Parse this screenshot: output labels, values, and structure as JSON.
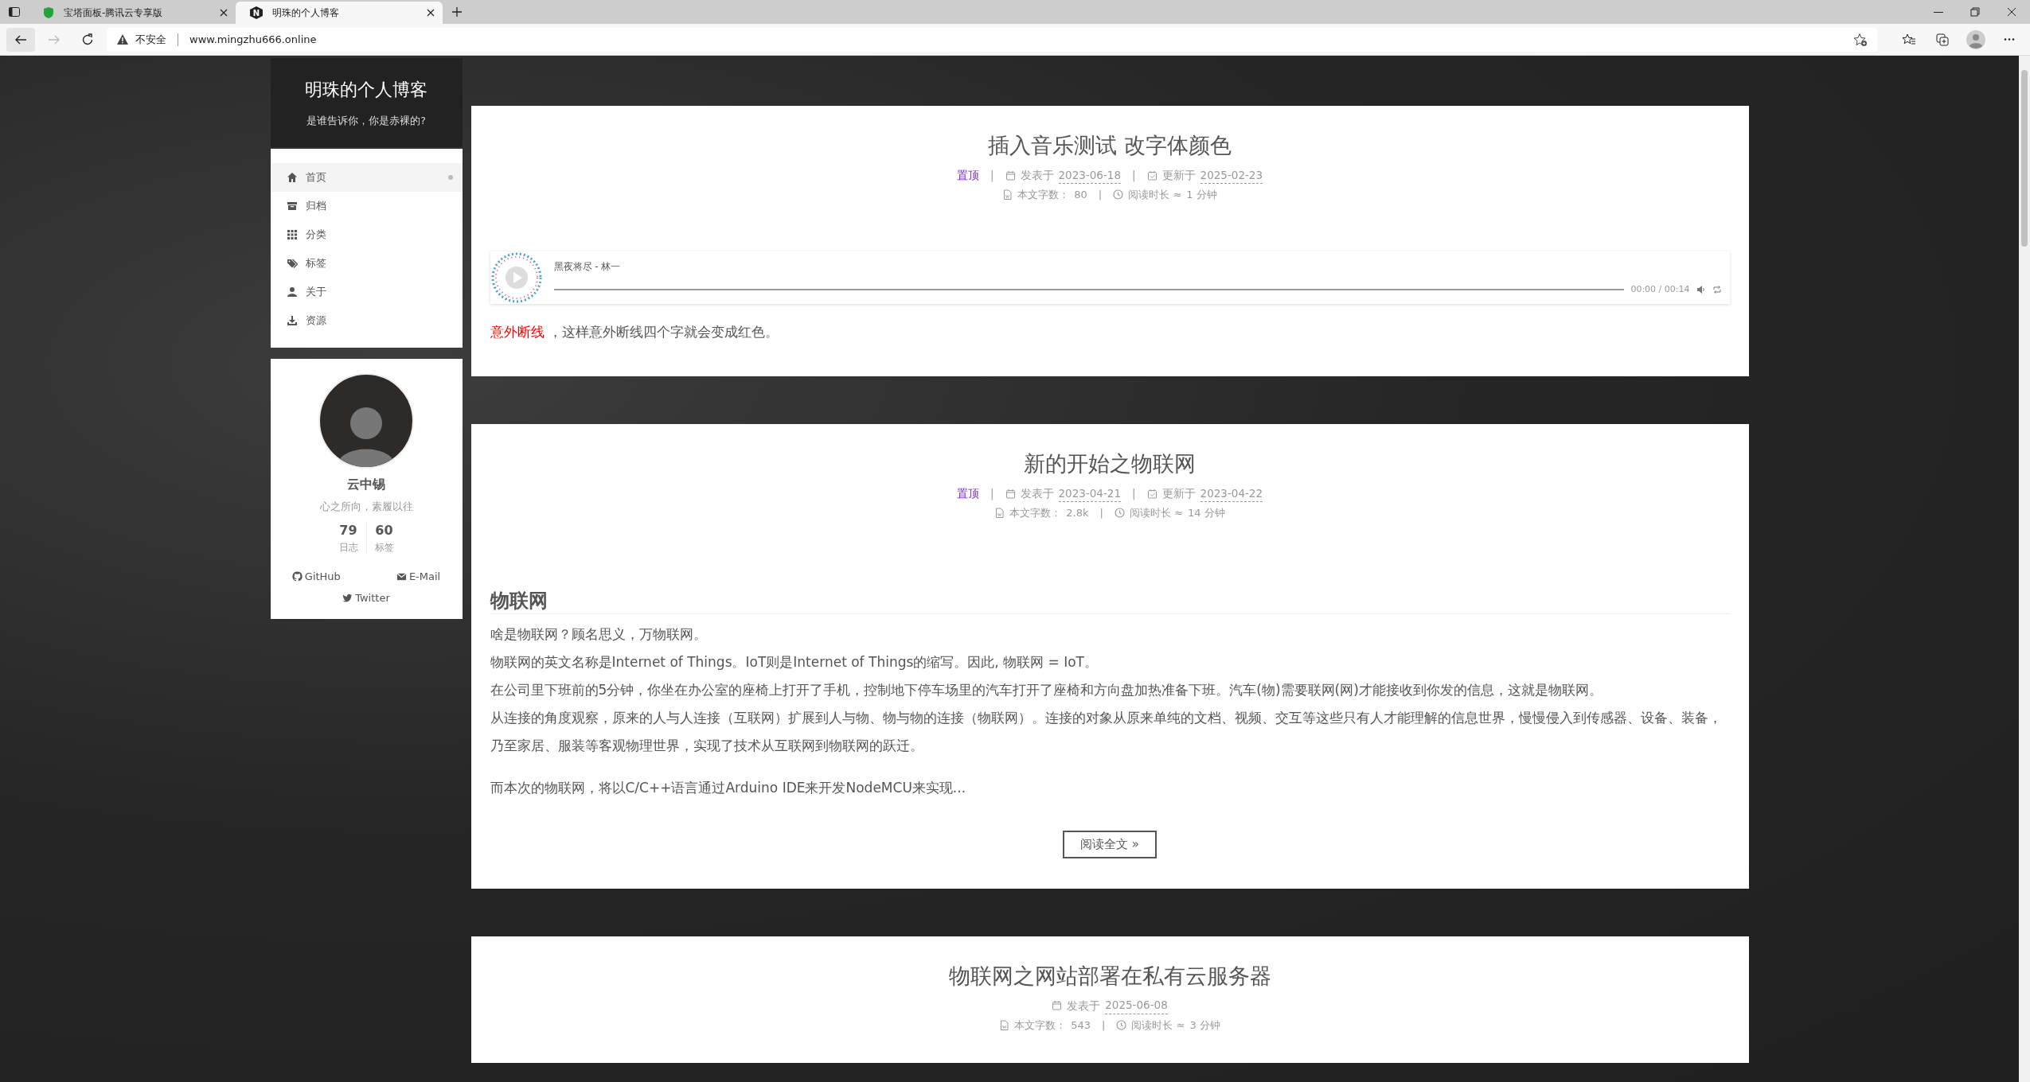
{
  "browser": {
    "tabs": [
      {
        "title": "宝塔面板-腾讯云专享版",
        "selected": false,
        "kind": "shield"
      },
      {
        "title": "明珠的个人博客",
        "selected": true,
        "kind": "letter",
        "favicon_text": "N"
      }
    ],
    "address": {
      "security": "不安全",
      "url": "www.mingzhu666.online"
    }
  },
  "site": {
    "title": "明珠的个人博客",
    "subtitle": "是谁告诉你，你是赤裸的?"
  },
  "menu": [
    {
      "label": "首页",
      "selected": true
    },
    {
      "label": "归档",
      "selected": false
    },
    {
      "label": "分类",
      "selected": false
    },
    {
      "label": "标签",
      "selected": false
    },
    {
      "label": "关于",
      "selected": false
    },
    {
      "label": "资源",
      "selected": false
    }
  ],
  "author": {
    "name": "云中锡",
    "motto": "心之所向，素履以往",
    "stats": [
      {
        "value": "79",
        "label": "日志"
      },
      {
        "value": "60",
        "label": "标签"
      }
    ],
    "links": [
      {
        "label": "GitHub"
      },
      {
        "label": "E-Mail"
      },
      {
        "label": "Twitter"
      }
    ]
  },
  "meta_separator": "|",
  "posts": [
    {
      "title": "插入音乐测试 改字体颜色",
      "sticky": "置顶",
      "published": {
        "label": "发表于",
        "date": "2023-06-18"
      },
      "updated": {
        "label": "更新于",
        "date": "2025-02-23"
      },
      "words": {
        "label": "本文字数：",
        "value": "80"
      },
      "readtime": {
        "label": "阅读时长 ≈",
        "value": "1 分钟"
      },
      "blocks": [
        {
          "kind": "player",
          "title": "黑夜将尽 - 林一",
          "time": "00:00 / 00:14",
          "level": 0
        },
        {
          "kind": "colored-paragraph",
          "parts": [
            {
              "text": "意外断线",
              "color": "#ff0000"
            },
            {
              "text": " ，这样意外断线四个字就会变成红色。"
            }
          ]
        }
      ]
    },
    {
      "title": "新的开始之物联网",
      "sticky": "置顶",
      "published": {
        "label": "发表于",
        "date": "2023-04-21"
      },
      "updated": {
        "label": "更新于",
        "date": "2023-04-22"
      },
      "words": {
        "label": "本文字数：",
        "value": "2.8k"
      },
      "readtime": {
        "label": "阅读时长 ≈",
        "value": "14 分钟"
      },
      "blocks": [
        {
          "kind": "heading",
          "text": "物联网"
        },
        {
          "kind": "paragraph",
          "lines": [
            "啥是物联网？顾名思义，万物联网。",
            "物联网的英文名称是Internet of Things。IoT则是Internet of Things的缩写。因此, 物联网 = IoT。",
            "在公司里下班前的5分钟，你坐在办公室的座椅上打开了手机，控制地下停车场里的汽车打开了座椅和方向盘加热准备下班。汽车(物)需要联网(网)才能接收到你发的信息，这就是物联网。",
            "从连接的角度观察，原来的人与人连接（互联网）扩展到人与物、物与物的连接（物联网）。连接的对象从原来单纯的文档、视频、交互等这些只有人才能理解的信息世界，慢慢侵入到传感器、设备、装备，乃至家居、服装等客观物理世界，实现了技术从互联网到物联网的跃迁。"
          ]
        },
        {
          "kind": "paragraph",
          "lines": [
            "而本次的物联网，将以C/C++语言通过Arduino IDE来开发NodeMCU来实现..."
          ]
        },
        {
          "kind": "more-button",
          "text": "阅读全文 »"
        }
      ]
    },
    {
      "title": "物联网之网站部署在私有云服务器",
      "published": {
        "label": "发表于",
        "date": "2025-06-08"
      },
      "words": {
        "label": "本文字数：",
        "value": "543"
      },
      "readtime": {
        "label": "阅读时长 ≈",
        "value": "3 分钟"
      }
    }
  ]
}
